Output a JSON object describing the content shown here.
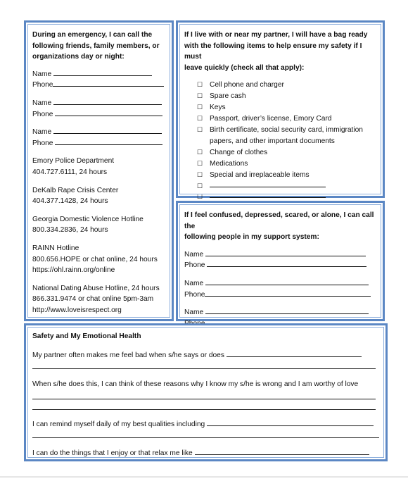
{
  "emergency_contacts": {
    "heading": "During an emergency, I can call the following friends, family members, or organizations day or night:",
    "heading_lines": [
      "During an emergency, I can call the",
      "following friends, family members, or",
      "organizations day or night:"
    ],
    "name_label": "Name",
    "phone_label": "Phone",
    "entries_count": 3,
    "resources": [
      {
        "lines": [
          "Emory Police Department",
          "404.727.6111, 24 hours"
        ]
      },
      {
        "lines": [
          "DeKalb Rape Crisis Center",
          "404.377.1428, 24 hours"
        ]
      },
      {
        "lines": [
          "Georgia Domestic Violence Hotline",
          "800.334.2836, 24 hours"
        ]
      },
      {
        "lines": [
          "RAINN Hotline",
          "800.656.HOPE or chat online, 24 hours",
          "https://ohl.rainn.org/online"
        ]
      },
      {
        "lines": [
          "National Dating Abuse Hotline, 24 hours",
          "866.331.9474 or chat online 5pm-3am",
          "http://www.loveisrespect.org"
        ]
      }
    ]
  },
  "bag_ready": {
    "heading_lines": [
      "If I live with or near my partner, I will have a bag ready",
      "with the following items to help ensure my safety if I must",
      "leave quickly (check all that apply):"
    ],
    "checkbox_glyph": "☐",
    "items": [
      {
        "lines": [
          "Cell phone and charger"
        ]
      },
      {
        "lines": [
          "Spare cash"
        ]
      },
      {
        "lines": [
          "Keys"
        ]
      },
      {
        "lines": [
          "Passport, driver’s license, Emory Card"
        ]
      },
      {
        "lines": [
          "Birth certificate, social security card, immigration",
          "papers, and other important documents"
        ]
      },
      {
        "lines": [
          "Change of clothes"
        ]
      },
      {
        "lines": [
          "Medications"
        ]
      },
      {
        "lines": [
          "Special and irreplaceable items"
        ]
      },
      {
        "lines": [],
        "blank": true
      },
      {
        "lines": [],
        "blank": true
      }
    ]
  },
  "support_system": {
    "heading_lines": [
      "If I feel confused, depressed, scared, or alone, I can call the",
      "following people in my support system:"
    ],
    "name_label": "Name",
    "phone_label": "Phone",
    "entries_count": 3
  },
  "emotional_health": {
    "title": "Safety and My Emotional Health",
    "prompts": [
      "My partner often makes me feel bad when s/he says or does",
      "When s/he does this, I can think of these reasons why I know my s/he is wrong and I am worthy of love",
      "I can remind myself daily of my best qualities including",
      "I can do the things that I enjoy or that relax me like"
    ]
  },
  "colors": {
    "border_outer": "#5b87c4",
    "border_inner": "#8fb0dd"
  }
}
